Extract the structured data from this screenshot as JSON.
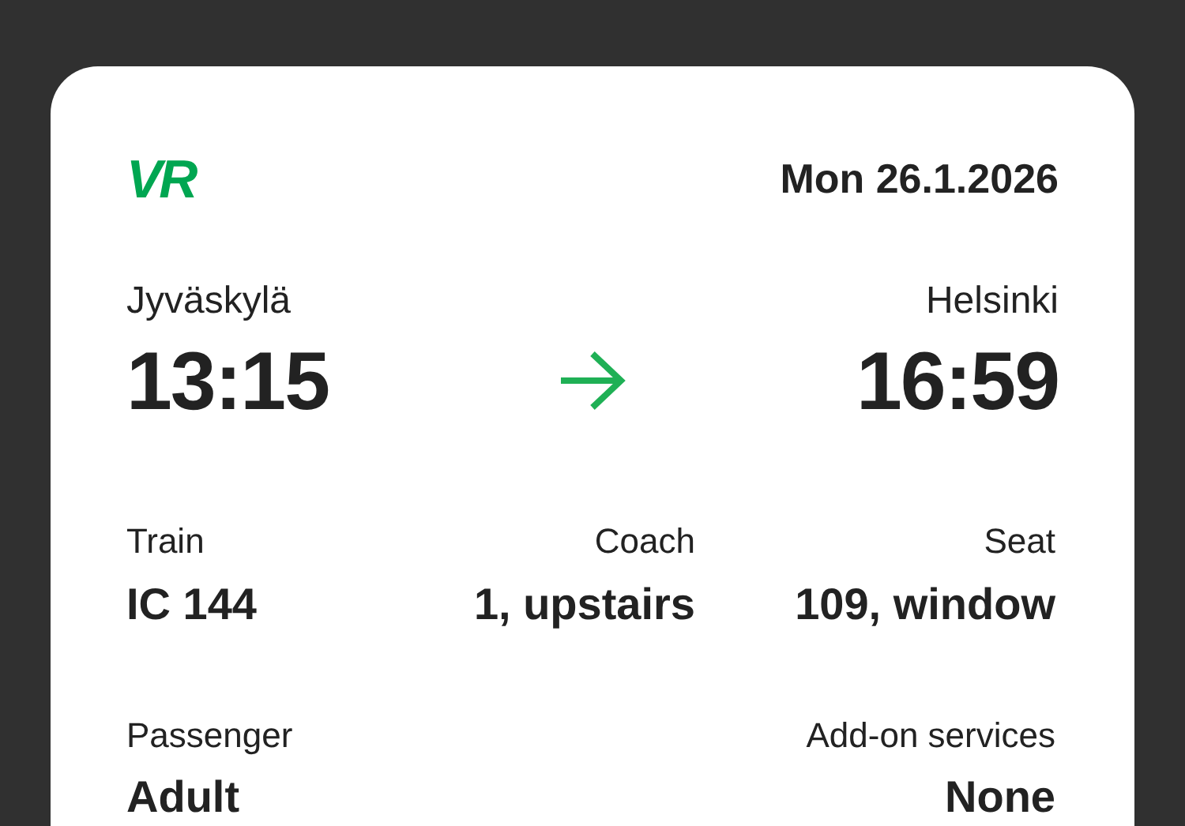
{
  "logo": "VR",
  "date": "Mon 26.1.2026",
  "departure": {
    "station": "Jyväskylä",
    "time": "13:15"
  },
  "arrival": {
    "station": "Helsinki",
    "time": "16:59"
  },
  "detail_rows": [
    [
      {
        "label": "Train",
        "value": "IC 144"
      },
      {
        "label": "Coach",
        "value": "1, upstairs"
      },
      {
        "label": "Seat",
        "value": "109, window"
      }
    ],
    [
      {
        "label": "Passenger",
        "value": "Adult"
      },
      {
        "label": "Add-on services",
        "value": "None"
      }
    ]
  ]
}
